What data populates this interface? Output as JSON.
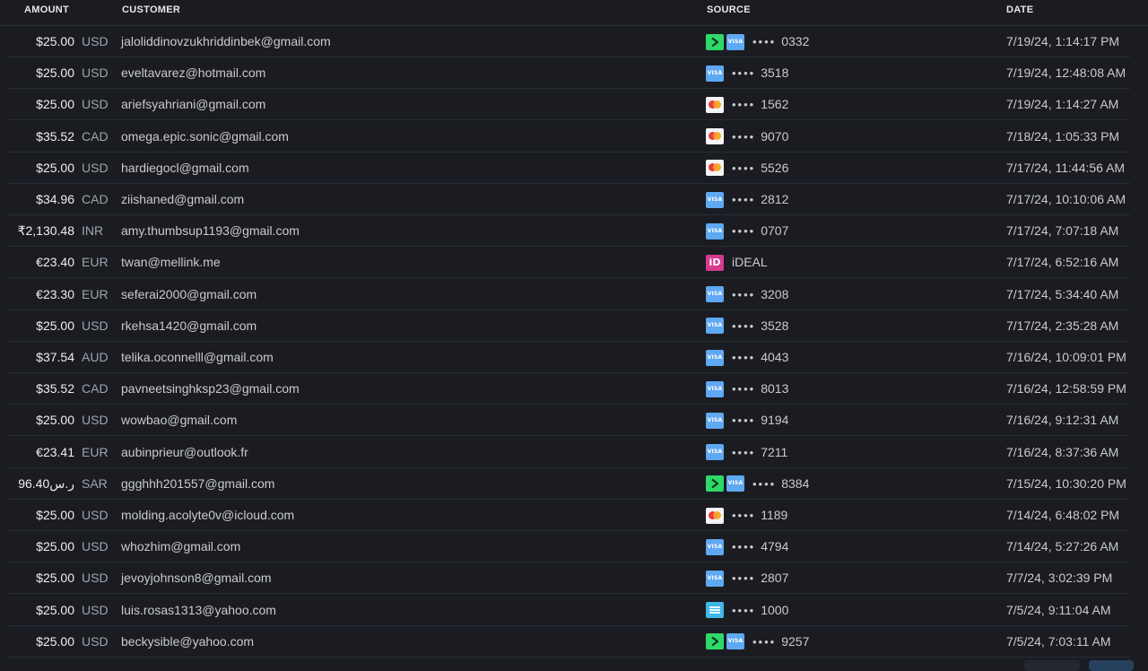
{
  "headers": {
    "amount": "AMOUNT",
    "customer": "CUSTOMER",
    "source": "SOURCE",
    "date": "DATE"
  },
  "rows": [
    {
      "amount": "$25.00",
      "currency": "USD",
      "customer": "jaloliddinovzukhriddinbek@gmail.com",
      "source_icons": [
        "link-icon",
        "visa-icon"
      ],
      "source_text": "0332",
      "masked": true,
      "date": "7/19/24, 1:14:17 PM"
    },
    {
      "amount": "$25.00",
      "currency": "USD",
      "customer": "eveltavarez@hotmail.com",
      "source_icons": [
        "visa-icon"
      ],
      "source_text": "3518",
      "masked": true,
      "date": "7/19/24, 12:48:08 AM"
    },
    {
      "amount": "$25.00",
      "currency": "USD",
      "customer": "ariefsyahriani@gmail.com",
      "source_icons": [
        "mastercard-icon"
      ],
      "source_text": "1562",
      "masked": true,
      "date": "7/19/24, 1:14:27 AM"
    },
    {
      "amount": "$35.52",
      "currency": "CAD",
      "customer": "omega.epic.sonic@gmail.com",
      "source_icons": [
        "mastercard-icon"
      ],
      "source_text": "9070",
      "masked": true,
      "date": "7/18/24, 1:05:33 PM"
    },
    {
      "amount": "$25.00",
      "currency": "USD",
      "customer": "hardiegocl@gmail.com",
      "source_icons": [
        "mastercard-icon"
      ],
      "source_text": "5526",
      "masked": true,
      "date": "7/17/24, 11:44:56 AM"
    },
    {
      "amount": "$34.96",
      "currency": "CAD",
      "customer": "ziishaned@gmail.com",
      "source_icons": [
        "visa-icon"
      ],
      "source_text": "2812",
      "masked": true,
      "date": "7/17/24, 10:10:06 AM"
    },
    {
      "amount": "₹2,130.48",
      "currency": "INR",
      "customer": "amy.thumbsup1193@gmail.com",
      "source_icons": [
        "visa-icon"
      ],
      "source_text": "0707",
      "masked": true,
      "date": "7/17/24, 7:07:18 AM"
    },
    {
      "amount": "€23.40",
      "currency": "EUR",
      "customer": "twan@mellink.me",
      "source_icons": [
        "ideal-icon"
      ],
      "source_text": "iDEAL",
      "masked": false,
      "date": "7/17/24, 6:52:16 AM"
    },
    {
      "amount": "€23.30",
      "currency": "EUR",
      "customer": "seferai2000@gmail.com",
      "source_icons": [
        "visa-icon"
      ],
      "source_text": "3208",
      "masked": true,
      "date": "7/17/24, 5:34:40 AM"
    },
    {
      "amount": "$25.00",
      "currency": "USD",
      "customer": "rkehsa1420@gmail.com",
      "source_icons": [
        "visa-icon"
      ],
      "source_text": "3528",
      "masked": true,
      "date": "7/17/24, 2:35:28 AM"
    },
    {
      "amount": "$37.54",
      "currency": "AUD",
      "customer": "telika.oconnelll@gmail.com",
      "source_icons": [
        "visa-icon"
      ],
      "source_text": "4043",
      "masked": true,
      "date": "7/16/24, 10:09:01 PM"
    },
    {
      "amount": "$35.52",
      "currency": "CAD",
      "customer": "pavneetsinghksp23@gmail.com",
      "source_icons": [
        "visa-icon"
      ],
      "source_text": "8013",
      "masked": true,
      "date": "7/16/24, 12:58:59 PM"
    },
    {
      "amount": "$25.00",
      "currency": "USD",
      "customer": "wowbao@gmail.com",
      "source_icons": [
        "visa-icon"
      ],
      "source_text": "9194",
      "masked": true,
      "date": "7/16/24, 9:12:31 AM"
    },
    {
      "amount": "€23.41",
      "currency": "EUR",
      "customer": "aubinprieur@outlook.fr",
      "source_icons": [
        "visa-icon"
      ],
      "source_text": "7211",
      "masked": true,
      "date": "7/16/24, 8:37:36 AM"
    },
    {
      "amount": "96.40ر.س",
      "currency": "SAR",
      "customer": "ggghhh201557@gmail.com",
      "source_icons": [
        "link-icon",
        "visa-icon"
      ],
      "source_text": "8384",
      "masked": true,
      "date": "7/15/24, 10:30:20 PM"
    },
    {
      "amount": "$25.00",
      "currency": "USD",
      "customer": "molding.acolyte0v@icloud.com",
      "source_icons": [
        "mastercard-icon"
      ],
      "source_text": "1189",
      "masked": true,
      "date": "7/14/24, 6:48:02 PM"
    },
    {
      "amount": "$25.00",
      "currency": "USD",
      "customer": "whozhim@gmail.com",
      "source_icons": [
        "visa-icon"
      ],
      "source_text": "4794",
      "masked": true,
      "date": "7/14/24, 5:27:26 AM"
    },
    {
      "amount": "$25.00",
      "currency": "USD",
      "customer": "jevoyjohnson8@gmail.com",
      "source_icons": [
        "visa-icon"
      ],
      "source_text": "2807",
      "masked": true,
      "date": "7/7/24, 3:02:39 PM"
    },
    {
      "amount": "$25.00",
      "currency": "USD",
      "customer": "luis.rosas1313@yahoo.com",
      "source_icons": [
        "generic-card-icon"
      ],
      "source_text": "1000",
      "masked": true,
      "date": "7/5/24, 9:11:04 AM"
    },
    {
      "amount": "$25.00",
      "currency": "USD",
      "customer": "beckysible@yahoo.com",
      "source_icons": [
        "link-icon",
        "visa-icon"
      ],
      "source_text": "9257",
      "masked": true,
      "date": "7/5/24, 7:03:11 AM"
    }
  ],
  "mask": "••••",
  "visa_mark": "VISA",
  "ideal_mark": "iD",
  "colors": {
    "background": "#1a1c22",
    "link": "#2fd86a",
    "visa": "#5fa8f2",
    "ideal": "#d63a8f"
  }
}
